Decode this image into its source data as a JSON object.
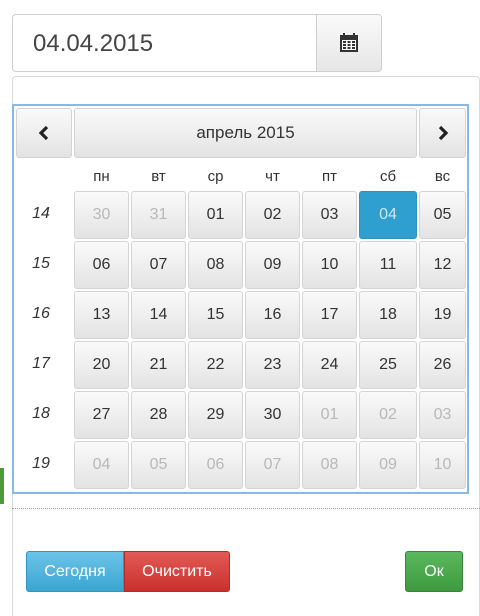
{
  "date_field": {
    "value": "04.04.2015",
    "button_icon": "calendar-icon"
  },
  "calendar": {
    "month_label": "апрель 2015",
    "prev_icon": "chevron-left-icon",
    "next_icon": "chevron-right-icon",
    "weekdays": [
      "пн",
      "вт",
      "ср",
      "чт",
      "пт",
      "сб",
      "вс"
    ],
    "weeks": [
      {
        "number": "14",
        "days": [
          {
            "label": "30",
            "muted": true
          },
          {
            "label": "31",
            "muted": true
          },
          {
            "label": "01",
            "muted": false
          },
          {
            "label": "02",
            "muted": false
          },
          {
            "label": "03",
            "muted": false
          },
          {
            "label": "04",
            "muted": false,
            "selected": true
          },
          {
            "label": "05",
            "muted": false
          }
        ]
      },
      {
        "number": "15",
        "days": [
          {
            "label": "06"
          },
          {
            "label": "07"
          },
          {
            "label": "08"
          },
          {
            "label": "09"
          },
          {
            "label": "10"
          },
          {
            "label": "11"
          },
          {
            "label": "12"
          }
        ]
      },
      {
        "number": "16",
        "days": [
          {
            "label": "13"
          },
          {
            "label": "14"
          },
          {
            "label": "15"
          },
          {
            "label": "16"
          },
          {
            "label": "17"
          },
          {
            "label": "18"
          },
          {
            "label": "19"
          }
        ]
      },
      {
        "number": "17",
        "days": [
          {
            "label": "20"
          },
          {
            "label": "21"
          },
          {
            "label": "22"
          },
          {
            "label": "23"
          },
          {
            "label": "24"
          },
          {
            "label": "25"
          },
          {
            "label": "26"
          }
        ]
      },
      {
        "number": "18",
        "days": [
          {
            "label": "27"
          },
          {
            "label": "28"
          },
          {
            "label": "29"
          },
          {
            "label": "30"
          },
          {
            "label": "01",
            "muted": true
          },
          {
            "label": "02",
            "muted": true
          },
          {
            "label": "03",
            "muted": true
          }
        ]
      },
      {
        "number": "19",
        "days": [
          {
            "label": "04",
            "muted": true
          },
          {
            "label": "05",
            "muted": true
          },
          {
            "label": "06",
            "muted": true
          },
          {
            "label": "07",
            "muted": true
          },
          {
            "label": "08",
            "muted": true
          },
          {
            "label": "09",
            "muted": true
          },
          {
            "label": "10",
            "muted": true
          }
        ]
      }
    ],
    "colors": {
      "selected": "#2e9fcf",
      "today_button": "#3aa5d1",
      "clear_button": "#c9302c",
      "ok_button": "#5cb85c"
    }
  },
  "footer": {
    "today_label": "Сегодня",
    "clear_label": "Очистить",
    "ok_label": "Ок"
  }
}
